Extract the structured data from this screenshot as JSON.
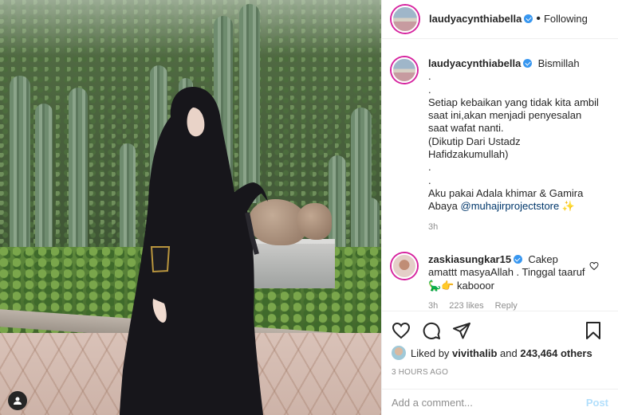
{
  "header": {
    "username": "laudyacynthiabella",
    "separator": "•",
    "follow_status": "Following"
  },
  "caption": {
    "username": "laudyacynthiabella",
    "lines": [
      "Bismillah",
      ".",
      ".",
      "Setiap kebaikan yang tidak kita ambil saat ini,akan menjadi penyesalan saat wafat nanti.",
      "(Dikutip Dari Ustadz Hafidzakumullah)",
      ".",
      ".",
      "Aku pakai Adala khimar & Gamira Abaya"
    ],
    "mention": "@muhajirprojectstore",
    "emoji": "✨",
    "time": "3h"
  },
  "comment": {
    "username": "zaskiasungkar15",
    "text": "Cakep amattt masyaAllah . Tinggal taaruf",
    "emoji1": "🦕",
    "emoji2": "👉",
    "text_end": "kabooor",
    "time": "3h",
    "likes": "223 likes",
    "reply": "Reply"
  },
  "likes": {
    "prefix": "Liked by",
    "user": "vivithalib",
    "middle": "and",
    "count": "243,464 others"
  },
  "posted_ago": "3 HOURS AGO",
  "add_comment": {
    "placeholder": "Add a comment...",
    "post_label": "Post"
  },
  "colors": {
    "verified": "#3897f0",
    "mention": "#00376b",
    "post_button": "#b2dffc",
    "story_ring": "#d6249f"
  },
  "icons": [
    "verified-badge-icon",
    "heart-icon",
    "comment-icon",
    "share-icon",
    "bookmark-icon",
    "small-heart-icon",
    "user-tag-icon"
  ]
}
